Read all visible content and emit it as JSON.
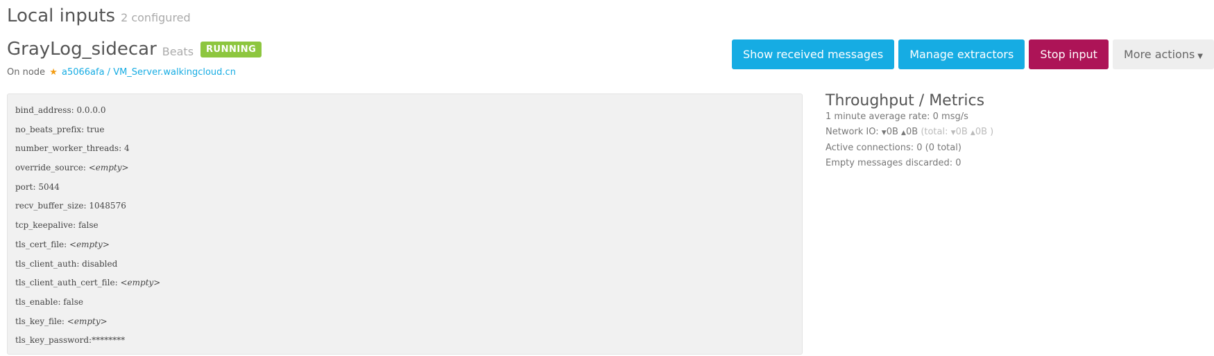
{
  "page": {
    "title": "Local inputs",
    "subtitle": "2 configured"
  },
  "input": {
    "name": "GrayLog_sidecar",
    "type": "Beats",
    "status": "RUNNING",
    "node_prefix": "On node",
    "node_icon": "star-icon",
    "node_link": "a5066afa / VM_Server.walkingcloud.cn"
  },
  "actions": {
    "show_messages": "Show received messages",
    "manage_extractors": "Manage extractors",
    "stop_input": "Stop input",
    "more_actions": "More actions"
  },
  "config": [
    {
      "key": "bind_address",
      "value": "0.0.0.0",
      "empty": false
    },
    {
      "key": "no_beats_prefix",
      "value": "true",
      "empty": false
    },
    {
      "key": "number_worker_threads",
      "value": "4",
      "empty": false
    },
    {
      "key": "override_source",
      "value": "<empty>",
      "empty": true
    },
    {
      "key": "port",
      "value": "5044",
      "empty": false
    },
    {
      "key": "recv_buffer_size",
      "value": "1048576",
      "empty": false
    },
    {
      "key": "tcp_keepalive",
      "value": "false",
      "empty": false
    },
    {
      "key": "tls_cert_file",
      "value": "<empty>",
      "empty": true
    },
    {
      "key": "tls_client_auth",
      "value": "disabled",
      "empty": false
    },
    {
      "key": "tls_client_auth_cert_file",
      "value": "<empty>",
      "empty": true
    },
    {
      "key": "tls_enable",
      "value": "false",
      "empty": false
    },
    {
      "key": "tls_key_file",
      "value": "<empty>",
      "empty": true
    },
    {
      "key": "tls_key_password",
      "value": "********",
      "empty": false
    }
  ],
  "metrics": {
    "title": "Throughput / Metrics",
    "rate": "1 minute average rate: 0 msg/s",
    "network_label": "Network IO:",
    "net_in": "0B",
    "net_out": "0B",
    "total_label": "(total:",
    "total_in": "0B",
    "total_out": "0B",
    "total_close": ")",
    "connections": "Active connections: 0 (0 total)",
    "empty_discarded": "Empty messages discarded: 0"
  }
}
